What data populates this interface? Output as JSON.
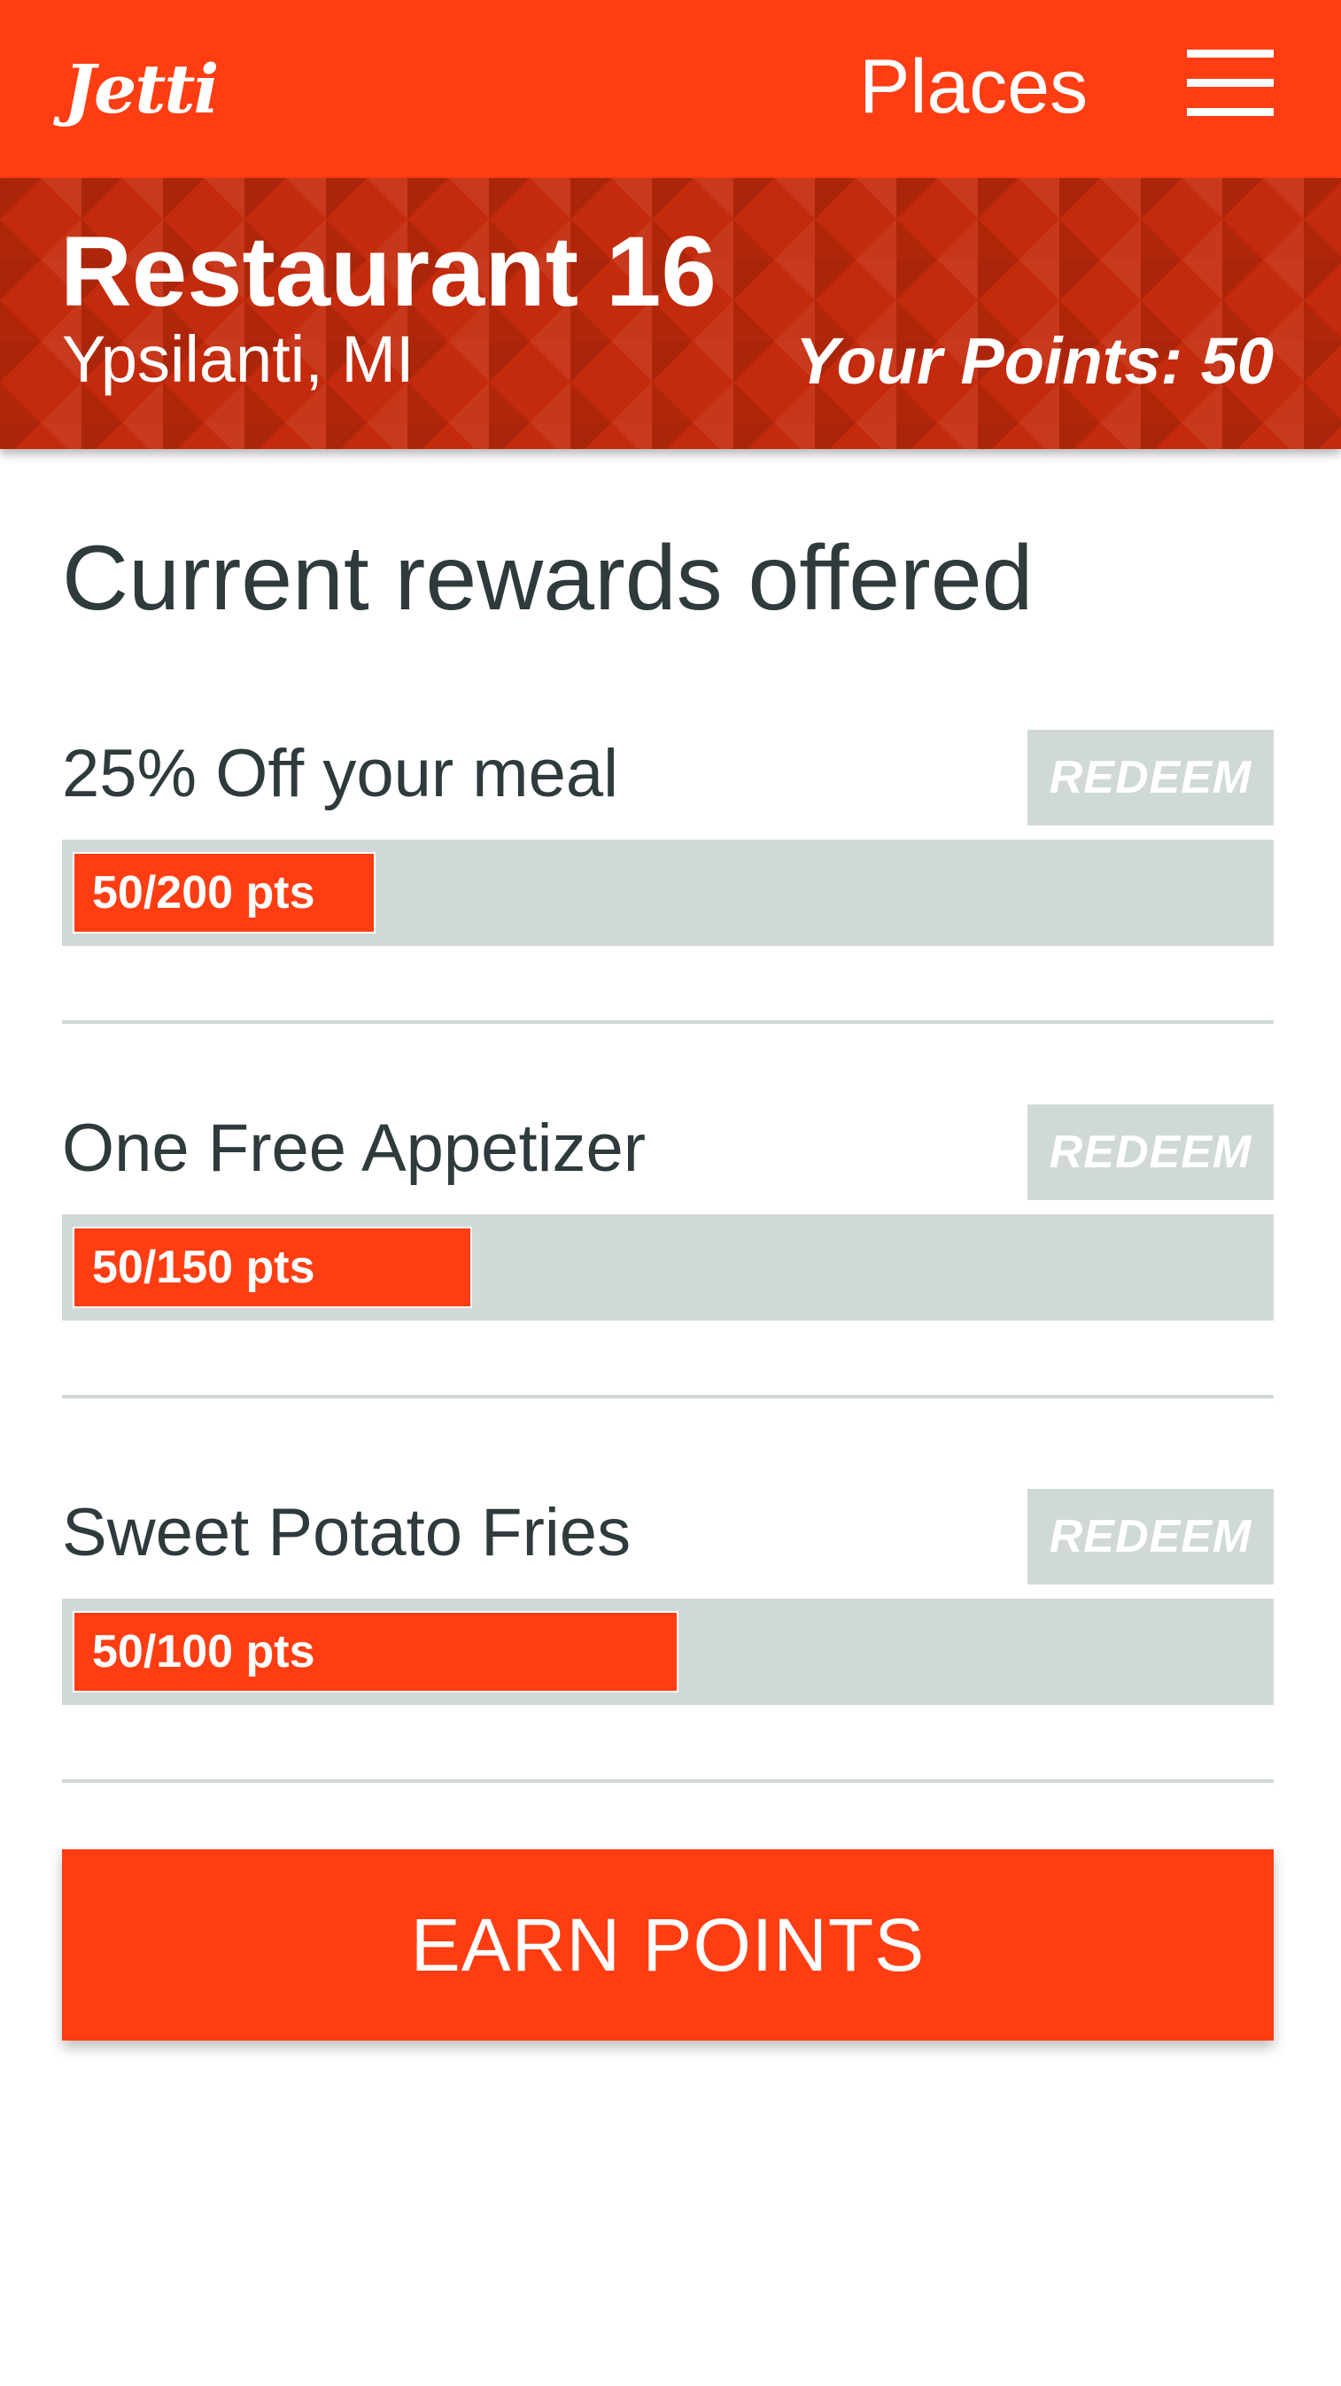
{
  "header": {
    "logo": "Jetti",
    "nav_title": "Places",
    "menu_icon": "hamburger-menu-icon"
  },
  "banner": {
    "name": "Restaurant 16",
    "location": "Ypsilanti, MI",
    "points_text": "Your Points: 50",
    "points_value": 50
  },
  "rewards_title": "Current rewards offered",
  "rewards": [
    {
      "name": "25% Off your meal",
      "redeem_label": "REDEEM",
      "progress_label": "50/200 pts",
      "current": 50,
      "required": 200,
      "progress_fraction": 0.25
    },
    {
      "name": "One Free Appetizer",
      "redeem_label": "REDEEM",
      "progress_label": "50/150 pts",
      "current": 50,
      "required": 150,
      "progress_fraction": 0.33
    },
    {
      "name": "Sweet Potato Fries",
      "redeem_label": "REDEEM",
      "progress_label": "50/100 pts",
      "current": 50,
      "required": 100,
      "progress_fraction": 0.5
    }
  ],
  "earn_button_label": "EARN POINTS",
  "colors": {
    "accent": "#ff3d12",
    "banner": "#c42a0c",
    "muted": "#d1d9d8",
    "text": "#2f3a3c"
  }
}
